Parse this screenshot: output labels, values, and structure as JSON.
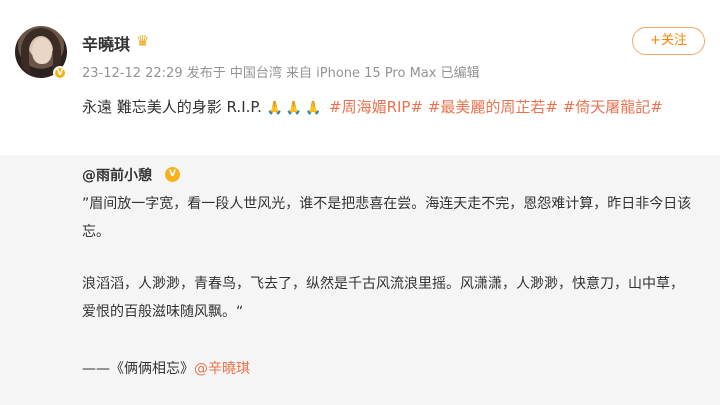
{
  "post": {
    "author_name": "辛曉琪",
    "member_badge_icon": "crown-icon",
    "meta": "23-12-12 22:29  发布于  中国台湾  来自 iPhone 15 Pro Max 已编辑",
    "follow_label": "+关注",
    "text": "永遠 難忘美人的身影 R.I.P.",
    "emoji": "🙏🙏🙏",
    "hashtags": [
      "#周海媚RIP#",
      "#最美麗的周芷若#",
      "#倚天屠龍記#"
    ],
    "accent_color": "#eb7350"
  },
  "repost": {
    "author": "@雨前小憩",
    "verified_icon": "verified-badge-icon",
    "paragraph1": "”眉间放一字宽，看一段人世风光，谁不是把悲喜在尝。海连天走不完，恩怨难计算，昨日非今日该忘。",
    "paragraph2": "浪滔滔，人渺渺，青春鸟，飞去了，纵然是千古风流浪里摇。风潇潇，人渺渺，快意刀，山中草，爱恨的百般滋味随风飘。“",
    "sign_prefix": "——《俩俩相忘》",
    "sign_mention": "@辛曉琪"
  }
}
